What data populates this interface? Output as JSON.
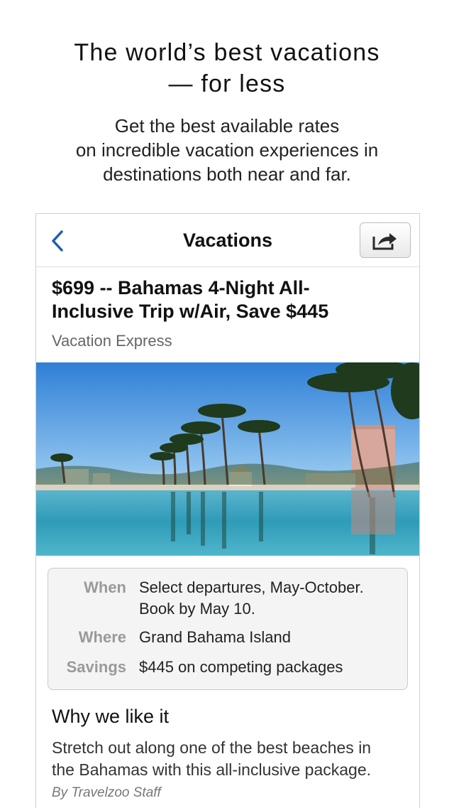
{
  "hero": {
    "title_line1": "The world’s best vacations",
    "title_line2": "— for less",
    "subtitle_line1": "Get the best available rates",
    "subtitle_line2": "on incredible vacation experiences in",
    "subtitle_line3": "destinations both near and far."
  },
  "navbar": {
    "title": "Vacations",
    "back_icon": "chevron-left-icon",
    "share_icon": "share-icon"
  },
  "deal": {
    "title_line1": "$699 -- Bahamas 4-Night All-",
    "title_line2": "Inclusive Trip w/Air, Save $445",
    "provider": "Vacation Express"
  },
  "details": {
    "when_label": "When",
    "when_value_line1": "Select departures, May-October.",
    "when_value_line2": "Book by May 10.",
    "where_label": "Where",
    "where_value": "Grand Bahama Island",
    "savings_label": "Savings",
    "savings_value": "$445 on competing packages"
  },
  "why": {
    "title": "Why we like it",
    "text_line1": "Stretch out along one of the best beaches in",
    "text_line2": "the Bahamas with this all-inclusive package.",
    "byline": "By Travelzoo Staff"
  },
  "colors": {
    "accent": "#1a5fb4",
    "label_gray": "#9a9a9a"
  }
}
